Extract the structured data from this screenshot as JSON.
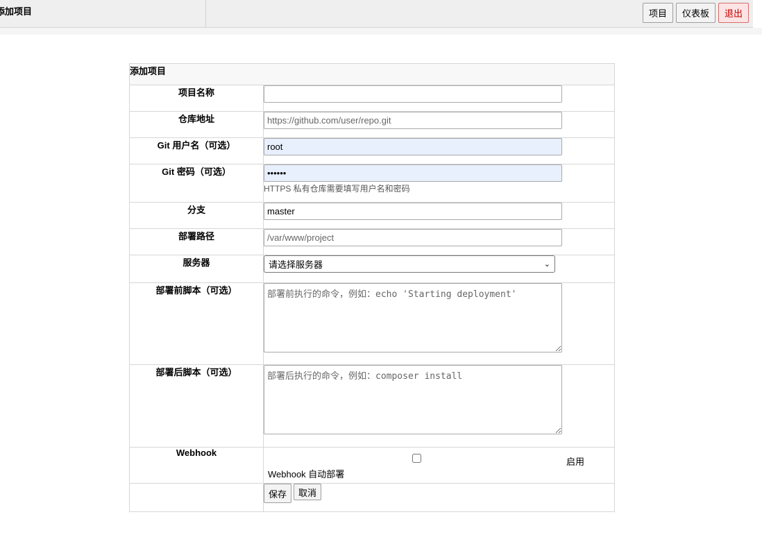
{
  "header": {
    "title": "添加项目",
    "nav": {
      "projects": "项目",
      "dashboard": "仪表板",
      "logout": "退出"
    }
  },
  "form": {
    "caption": "添加项目",
    "project_name": {
      "label": "项目名称",
      "value": ""
    },
    "repo_url": {
      "label": "仓库地址",
      "placeholder": "https://github.com/user/repo.git"
    },
    "git_user": {
      "label": "Git 用户名（可选）",
      "value": "root"
    },
    "git_password": {
      "label": "Git 密码（可选）",
      "value": "••••••",
      "hint": "HTTPS 私有仓库需要填写用户名和密码"
    },
    "branch": {
      "label": "分支",
      "value": "master"
    },
    "deploy_path": {
      "label": "部署路径",
      "placeholder": "/var/www/project"
    },
    "server": {
      "label": "服务器",
      "selected": "请选择服务器"
    },
    "pre_script": {
      "label": "部署前脚本（可选）",
      "placeholder": "部署前执行的命令，例如：echo 'Starting deployment'"
    },
    "post_script": {
      "label": "部署后脚本（可选）",
      "placeholder": "部署后执行的命令，例如：composer install"
    },
    "webhook": {
      "label": "Webhook",
      "enable_text": "启用",
      "description": "Webhook 自动部署"
    },
    "save_label": "保存",
    "cancel_label": "取消"
  }
}
